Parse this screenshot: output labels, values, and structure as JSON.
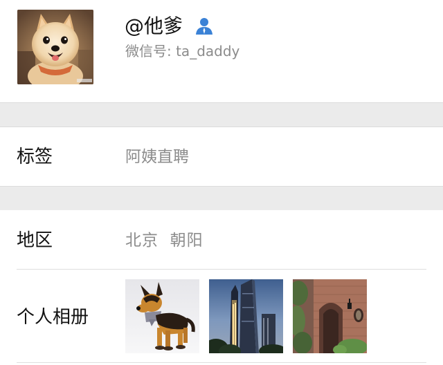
{
  "profile": {
    "nickname": "@他爹",
    "wechat_id": "微信号: ta_daddy",
    "avatar_icon": "pomeranian-dog-photo",
    "gender_icon": "male-person-icon",
    "gender_color": "#3b82d6"
  },
  "rows": {
    "tag": {
      "label": "标签",
      "value": "阿姨直聘"
    },
    "region": {
      "label": "地区",
      "value": "北京  朝阳"
    },
    "album": {
      "label": "个人相册",
      "photos": [
        "german-shepherd-figurine",
        "skyscraper-night",
        "old-brick-building"
      ]
    }
  },
  "colors": {
    "background": "#ffffff",
    "section_gap": "#ebebeb",
    "secondary_text": "#8c8c8c",
    "primary_text": "#111111"
  }
}
